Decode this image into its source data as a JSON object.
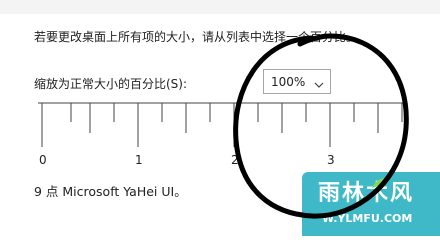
{
  "description": "若要更改桌面上所有项的大小，请从列表中选择一个百分比。",
  "scale_label": "缩放为正常大小的百分比(S):",
  "scale_select": {
    "selected": "100%"
  },
  "ruler": {
    "labels": [
      "0",
      "1",
      "2",
      "3"
    ]
  },
  "font_info": "9 点 Microsoft YaHei UI。",
  "watermark": {
    "title": "雨林木风",
    "url": "W.YLMFU.COM"
  },
  "annotation": {
    "stroke_color": "#000000"
  }
}
